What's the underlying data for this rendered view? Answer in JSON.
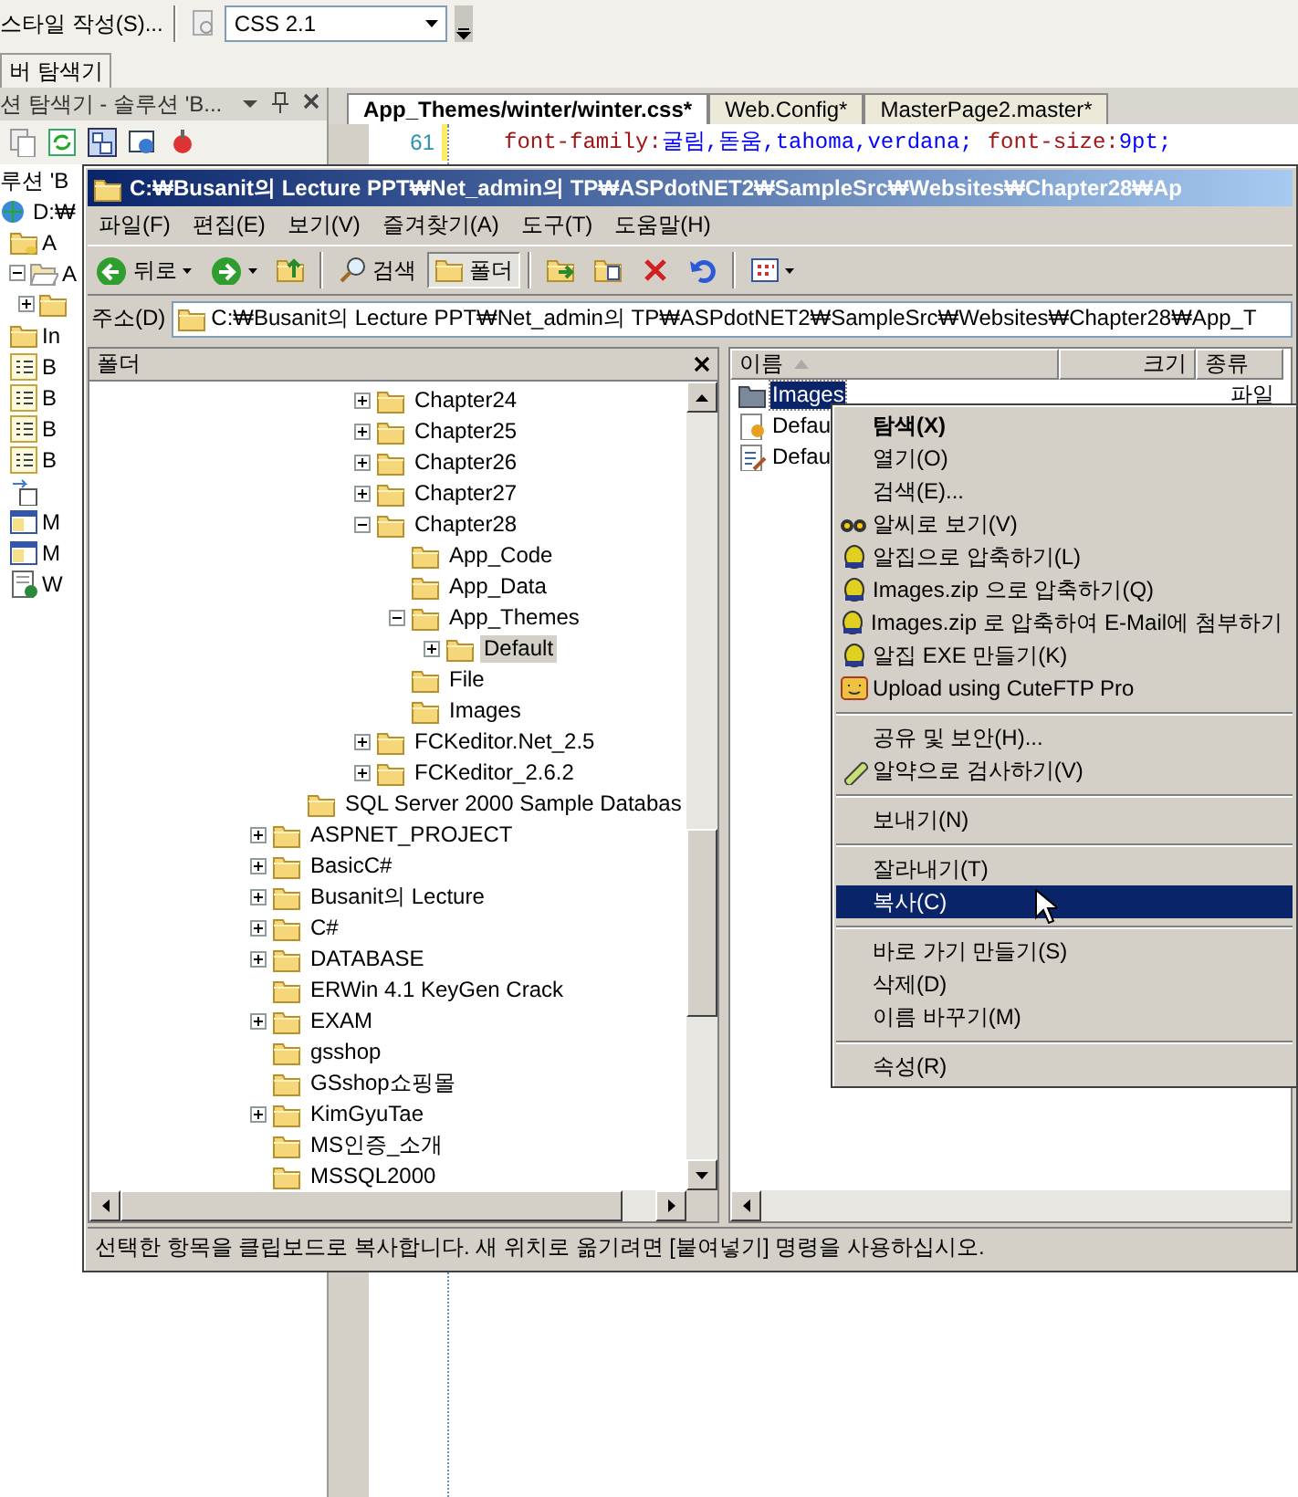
{
  "ide": {
    "toolbar": {
      "style_menu": "스타일 작성(S)...",
      "css_combo": "CSS 2.1"
    },
    "side_tab": "버 탐색기",
    "solution_explorer": {
      "title": "션 탐색기 - 솔루션 'B...",
      "items": [
        {
          "kind": "text",
          "label": "루션 'B"
        },
        {
          "kind": "web",
          "label": "D:₩",
          "children": [
            {
              "kind": "dbfolder",
              "label": "A"
            },
            {
              "kind": "openfolder",
              "label": "A",
              "expanded": true,
              "children": [
                {
                  "kind": "folder",
                  "expanded": false
                }
              ]
            },
            {
              "kind": "folder",
              "label": "In"
            },
            {
              "kind": "form",
              "label": "B"
            },
            {
              "kind": "form",
              "label": "B"
            },
            {
              "kind": "form",
              "label": "B"
            },
            {
              "kind": "form",
              "label": "B"
            },
            {
              "kind": "ref"
            },
            {
              "kind": "window",
              "label": "M"
            },
            {
              "kind": "window",
              "label": "M"
            },
            {
              "kind": "webdoc",
              "label": "W"
            }
          ]
        }
      ]
    },
    "editor": {
      "tabs": [
        {
          "label": "App_Themes/winter/winter.css*",
          "selected": true
        },
        {
          "label": "Web.Config*",
          "selected": false
        },
        {
          "label": "MasterPage2.master*",
          "selected": false
        }
      ],
      "lines": [
        {
          "number": "61",
          "property": "font-family:",
          "value": "굴림,돋움,tahoma,verdana;",
          "property2": "font-size:",
          "value2": "9pt;"
        }
      ]
    }
  },
  "explorer": {
    "title": "C:₩Busanit의 Lecture PPT₩Net_admin의 TP₩ASPdotNET2₩SampleSrc₩Websites₩Chapter28₩Ap",
    "menu": [
      "파일(F)",
      "편집(E)",
      "보기(V)",
      "즐겨찾기(A)",
      "도구(T)",
      "도움말(H)"
    ],
    "toolbar": [
      {
        "kind": "back",
        "label": "뒤로",
        "pressed": false
      },
      {
        "kind": "forward",
        "pressed": false
      },
      {
        "kind": "up",
        "pressed": false
      },
      {
        "kind": "separator"
      },
      {
        "kind": "search",
        "label": "검색",
        "pressed": false
      },
      {
        "kind": "folders",
        "label": "폴더",
        "pressed": true
      },
      {
        "kind": "separator"
      },
      {
        "kind": "move",
        "pressed": false
      },
      {
        "kind": "copy",
        "pressed": false
      },
      {
        "kind": "delete",
        "pressed": false
      },
      {
        "kind": "undo",
        "pressed": false
      },
      {
        "kind": "separator"
      },
      {
        "kind": "views",
        "pressed": false
      }
    ],
    "address": {
      "label": "주소(D)",
      "value": "C:₩Busanit의 Lecture PPT₩Net_admin의 TP₩ASPdotNET2₩SampleSrc₩Websites₩Chapter28₩App_T"
    },
    "folder_pane": {
      "title": "폴더",
      "tree": [
        {
          "children": [
            {
              "children": [
                {
                  "children": [
                    {
                      "label": "Chapter24",
                      "expanded": false,
                      "selected": false
                    },
                    {
                      "label": "Chapter25",
                      "expanded": false,
                      "selected": false
                    },
                    {
                      "label": "Chapter26",
                      "expanded": false,
                      "selected": false
                    },
                    {
                      "label": "Chapter27",
                      "expanded": false,
                      "selected": false
                    },
                    {
                      "label": "Chapter28",
                      "expanded": true,
                      "selected": false,
                      "children": [
                        {
                          "label": "App_Code",
                          "selected": false
                        },
                        {
                          "label": "App_Data",
                          "selected": false
                        },
                        {
                          "label": "App_Themes",
                          "expanded": true,
                          "selected": false,
                          "children": [
                            {
                              "label": "Default",
                              "expanded": false,
                              "selected": true
                            }
                          ]
                        },
                        {
                          "label": "File",
                          "selected": false
                        },
                        {
                          "label": "Images",
                          "selected": false
                        }
                      ]
                    },
                    {
                      "label": "FCKeditor.Net_2.5",
                      "expanded": false,
                      "selected": false
                    },
                    {
                      "label": "FCKeditor_2.6.2",
                      "expanded": false,
                      "selected": false
                    }
                  ]
                }
              ]
            },
            {
              "label": "SQL Server 2000 Sample Databas",
              "selected": false
            }
          ]
        },
        {
          "label": "ASPNET_PROJECT",
          "expanded": false,
          "selected": false
        },
        {
          "label": "BasicC#",
          "expanded": false,
          "selected": false
        },
        {
          "label": "Busanit의 Lecture",
          "expanded": false,
          "selected": false
        },
        {
          "label": "C#",
          "expanded": false,
          "selected": false
        },
        {
          "label": "DATABASE",
          "expanded": false,
          "selected": false
        },
        {
          "label": "ERWin 4.1 KeyGen Crack",
          "selected": false
        },
        {
          "label": "EXAM",
          "expanded": false,
          "selected": false
        },
        {
          "label": "gsshop",
          "selected": false
        },
        {
          "label": "GSshop쇼핑몰",
          "selected": false
        },
        {
          "label": "KimGyuTae",
          "expanded": false,
          "selected": false
        },
        {
          "label": "MS인증_소개",
          "selected": false
        },
        {
          "label": "MSSQL2000",
          "selected": false
        }
      ]
    },
    "file_list": {
      "columns": [
        {
          "label": "이름",
          "sorted": true
        },
        {
          "label": "크기",
          "sorted": false
        },
        {
          "label": "종류",
          "sorted": false
        }
      ],
      "rows": [
        {
          "kind": "folder",
          "name": "Images",
          "type_text": "파일",
          "selected": true
        },
        {
          "kind": "config",
          "name": "Defau",
          "selected": false
        },
        {
          "kind": "document",
          "name": "Defau",
          "selected": false
        }
      ]
    },
    "status_bar": "선택한 항목을 클립보드로 복사합니다. 새 위치로 옮기려면 [붙여넣기] 명령을 사용하십시오."
  },
  "context_menu": {
    "items": [
      {
        "kind": "plain",
        "label": "탐색(X)",
        "default": true,
        "selected": false
      },
      {
        "kind": "plain",
        "label": "열기(O)",
        "default": false,
        "selected": false
      },
      {
        "kind": "plain",
        "label": "검색(E)...",
        "default": false,
        "selected": false
      },
      {
        "kind": "viewer",
        "label": "알씨로 보기(V)",
        "default": false,
        "selected": false
      },
      {
        "kind": "zip",
        "label": "알집으로 압축하기(L)",
        "default": false,
        "selected": false
      },
      {
        "kind": "zip",
        "label": "Images.zip 으로 압축하기(Q)",
        "default": false,
        "selected": false
      },
      {
        "kind": "zip",
        "label": "Images.zip 로 압축하여 E-Mail에 첨부하기",
        "default": false,
        "selected": false
      },
      {
        "kind": "zip",
        "label": "알집 EXE 만들기(K)",
        "default": false,
        "selected": false
      },
      {
        "kind": "ftp",
        "label": "Upload using CuteFTP Pro",
        "default": false,
        "selected": false
      },
      {
        "kind": "separator"
      },
      {
        "kind": "plain",
        "label": "공유 및 보안(H)...",
        "default": false,
        "selected": false
      },
      {
        "kind": "scan",
        "label": "알약으로 검사하기(V)",
        "default": false,
        "selected": false
      },
      {
        "kind": "separator"
      },
      {
        "kind": "plain",
        "label": "보내기(N)",
        "default": false,
        "selected": false
      },
      {
        "kind": "separator"
      },
      {
        "kind": "plain",
        "label": "잘라내기(T)",
        "default": false,
        "selected": false
      },
      {
        "kind": "plain",
        "label": "복사(C)",
        "default": false,
        "selected": true
      },
      {
        "kind": "separator"
      },
      {
        "kind": "plain",
        "label": "바로 가기 만들기(S)",
        "default": false,
        "selected": false
      },
      {
        "kind": "plain",
        "label": "삭제(D)",
        "default": false,
        "selected": false
      },
      {
        "kind": "plain",
        "label": "이름 바꾸기(M)",
        "default": false,
        "selected": false
      },
      {
        "kind": "separator"
      },
      {
        "kind": "plain",
        "label": "속성(R)",
        "default": false,
        "selected": false
      }
    ]
  }
}
